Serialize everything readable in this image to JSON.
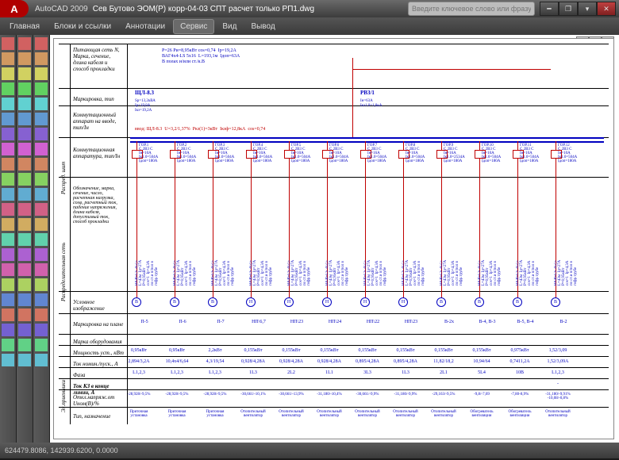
{
  "title": {
    "app": "AutoCAD 2009",
    "file": "Сев Бутово ЭОМ(Р) корр-04-03 СПТ расчет только РП1.dwg",
    "search_ph": "Введите ключевое слово или фразу"
  },
  "menu": {
    "items": [
      "Главная",
      "Блоки и ссылки",
      "Аннотации",
      "Сервис",
      "Вид",
      "Вывод"
    ],
    "active": 3
  },
  "section": {
    "vert": [
      "Распред. шит",
      "Распределительная сеть",
      "Эл.приемники"
    ],
    "rows": [
      "Питающая сеть\nN, Марка, сечение,\nдлина кабеля и\nспособ прокладки",
      "Маркировка, тип",
      "Коммутационный\nаппарат на\nвводе, тип/Iн",
      "Коммутационная\nаппаратура, тип/Iн",
      "Обозначение, марка, сечение,\nчисло, расчетная нагрузка, cosφ,\nрасчетный ток, падение\nнапряжения, длина кабеля,\nдопустимый ток, способ\nпрокладки",
      "Условное изображение",
      "Маркировка на плане",
      "Марка оборудования",
      "Мощность уст., кВт",
      "Ток номин./пуск., А",
      "Фаза",
      "Ток КЗ в конце линии, А",
      "Откл.напряж.от Uном(В)/%",
      "Тип, назначение"
    ]
  },
  "header_notes": "Р=26 Ри=8,95кВт cos=0,74  Ip=19,2А\nВАГ4х4-LS 5х16  L=193,1м  Iдоп=63А\nВ полах и/или ст./к.В",
  "panel": {
    "name": "ЩЛ-8.3",
    "lines": [
      "Sр=13,2кВА",
      "Iр=19,8А",
      "Iкз=19,2А"
    ]
  },
  "switch": {
    "name": "РВ3/1",
    "lines": [
      "Iн=63А",
      "Iкз1.0=1,8кА"
    ]
  },
  "input_line": "ввод: ЩЛ-8.3  U=3,2/1,37%  Ркз(1)=3кВт  Iкзф=12,8кА  cos=0,74",
  "breakers": [
    {
      "g": "ГОР.1",
      "t": "С 2В3 С",
      "i": "Iн=10А",
      "c": "Iк1.0=504А",
      "d": "Iдоп=180А"
    },
    {
      "g": "ГОР.2",
      "t": "С 2В3 С",
      "i": "Iн=10А",
      "c": "Iк1.0=504А",
      "d": "Iдоп=180А"
    },
    {
      "g": "ГОР.3",
      "t": "С 2В3 С",
      "i": "Iн=10А",
      "c": "Iк1.0=504А",
      "d": "Iдоп=180А"
    },
    {
      "g": "ГОР.4",
      "t": "С 2В3 С",
      "i": "Iн=10А",
      "c": "Iк1.0=504А",
      "d": "Iдоп=180А"
    },
    {
      "g": "ГОР.5",
      "t": "С 2В3 С",
      "i": "Iн=10А",
      "c": "Iк1.0=504А",
      "d": "Iдоп=180А"
    },
    {
      "g": "ГОР.6",
      "t": "С 2В3 С",
      "i": "Iн=10А",
      "c": "Iк1.0=504А",
      "d": "Iдоп=180А"
    },
    {
      "g": "ГОР.7",
      "t": "С 2В3 С",
      "i": "Iн=16А",
      "c": "Iк1.0=504А",
      "d": "Iдоп=180А"
    },
    {
      "g": "ГОР.8",
      "t": "С 2В3 С",
      "i": "Iн=10А",
      "c": "Iк1.0=504А",
      "d": "Iдоп=180А"
    },
    {
      "g": "ГОР.9",
      "t": "С 2В3 С",
      "i": "Iн=16А",
      "c": "Iк1.0=2534А",
      "d": "Iдоп=180А"
    },
    {
      "g": "ГОР.10",
      "t": "С 2В3 С",
      "i": "Iн=10А",
      "c": "Iк1.0=504А",
      "d": "Iдоп=180А"
    },
    {
      "g": "ГОР.11",
      "t": "С 2В3 С",
      "i": "Iн=10А",
      "c": "Iк1.0=504А",
      "d": "Iдоп=180А"
    },
    {
      "g": "ГОР.12",
      "t": "С 2В3 С",
      "i": "Iн=10А",
      "c": "Iк1.0=504А",
      "d": "Iдоп=180А"
    }
  ],
  "cable": "ВА46-LS 3х2,5\nL=43м  Iд=27А\nР=0,95кВт\ncos=1  Iр=4,3А\nпо ст.и п/пол в\nгофр.трубе",
  "symbols": [
    "В",
    "В",
    "В",
    "Н",
    "Н",
    "Н",
    "Н",
    "Н",
    "В",
    "В",
    "В",
    "В"
  ],
  "marks": [
    "П-5",
    "П-6",
    "П-7",
    "НП\\6,7",
    "НП\\23",
    "НП\\24",
    "НП\\22",
    "НП\\23",
    "В-2х",
    "В-4, В-3",
    "В-5, В-4",
    "В-2"
  ],
  "table": {
    "power": [
      "0,95кВт",
      "0,95кВт",
      "2,2кВт",
      "0,155кВт",
      "0,155кВт",
      "0,155кВт",
      "0,155кВт",
      "0,155кВт",
      "0,155кВт",
      "0,155кВт",
      "0,975кВт",
      "1,52/3,09"
    ],
    "current": [
      "2,894/3,2А",
      "10,4х4/6,64",
      "4,3/19,54",
      "0,928/4,28А",
      "0,928/4,28А",
      "0,928/4,28А",
      "0,895/4,28А",
      "0,895/4,28А",
      "11,82/18,2",
      "10,94/64",
      "0,7411,2А",
      "1,52/3,09А"
    ],
    "phase": [
      "L1,2,3",
      "L1,2,3",
      "L1,2,3",
      "1L3",
      "2L2",
      "1L1",
      "3L3",
      "1L3",
      "2L1",
      "5L4",
      "10В",
      "L1,2,3"
    ],
    "kz": [
      "",
      "",
      "",
      "",
      "",
      "",
      "",
      "",
      "",
      "",
      "",
      "-"
    ],
    "du": [
      "-28,928/-9,5%",
      "-28,928/-9,5%",
      "-28,928/-9,5%",
      "-30,661/-10,1%",
      "-30,661/-13,9%",
      "-31,180/-10,4%",
      "-30,661/-9,9%",
      "-31,180/-9,9%",
      "-29,163/-9,5%",
      "-9,8/-7,69",
      "-7,80-8,9%",
      "-31,180/-9,91%\n-10,08/-0,8%"
    ],
    "type": [
      "Приточная\nустановка",
      "Приточная\nустановка",
      "Приточная\nустановка",
      "Отопительный\nвентилятор",
      "Отопительный\nвентилятор",
      "Отопительный\nвентилятор",
      "Отопительный\nвентилятор",
      "Отопительный\nвентилятор",
      "Отопительный\nвентилятор",
      "Обогреватель\nвентиляции",
      "Обогреватель\nвентиляции",
      "Отопительный\nвентилятор"
    ]
  },
  "status": "624479.8086, 142939.6200, 0.0000"
}
